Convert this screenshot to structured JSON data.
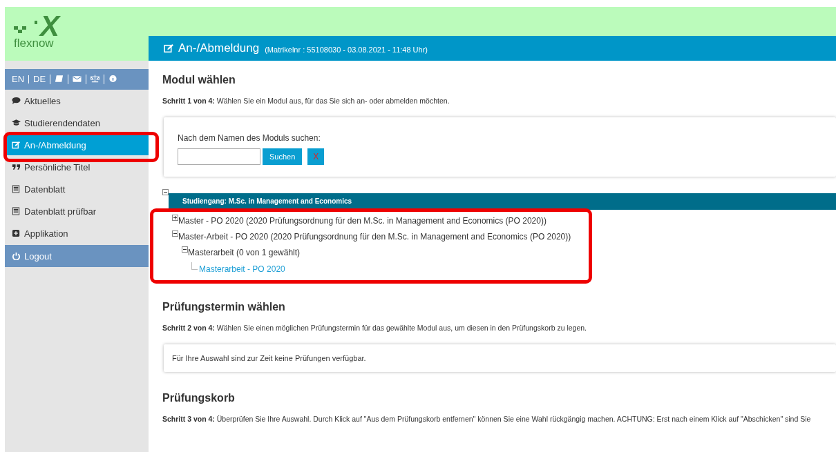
{
  "logo": {
    "mark": "X",
    "name": "flexnow"
  },
  "languages": [
    {
      "label": "EN",
      "selected": false
    },
    {
      "label": "DE",
      "selected": false
    }
  ],
  "sidebar": {
    "items": [
      {
        "label": "Aktuelles",
        "selected": false,
        "kind": "link"
      },
      {
        "label": "Studierendendaten",
        "selected": false,
        "kind": "link"
      },
      {
        "label": "An-/Abmeldung",
        "selected": true,
        "kind": "link"
      },
      {
        "label": "Persönliche Titel",
        "selected": false,
        "kind": "link"
      },
      {
        "label": "Datenblatt",
        "selected": false,
        "kind": "link"
      },
      {
        "label": "Datenblatt prüfbar",
        "selected": false,
        "kind": "link"
      },
      {
        "label": "Applikation",
        "selected": false,
        "kind": "link"
      },
      {
        "label": "Logout",
        "selected": false,
        "kind": "action"
      }
    ]
  },
  "page_title": {
    "title": "An-/Abmeldung",
    "subtitle": "(Matrikelnr : 55108030 - 03.08.2021 - 11:48 Uhr)"
  },
  "sections": [
    {
      "heading": "Modul wählen",
      "step": "**Schritt 1 von 4:** Wählen Sie ein Modul aus, für das Sie sich an- oder abmelden möchten.",
      "kind": "search",
      "search": {
        "label": "Nach dem Namen des Moduls suchen:",
        "button": "Suchen",
        "clear": "X"
      },
      "tree": {
        "label": "Studiengang: M.Sc. in Management and Economics",
        "expanded": true,
        "children": [
          {
            "label": "Master - PO 2020 (2020 Prüfungsordnung für den M.Sc. in Management and Economics (PO 2020))",
            "expanded": false
          },
          {
            "label": "Master-Arbeit - PO 2020 (2020 Prüfungsordnung für den M.Sc. in Management and Economics (PO 2020))",
            "expanded": true,
            "children": [
              {
                "label": "Masterarbeit (0 von 1 gewählt)",
                "expanded": true,
                "children": [
                  {
                    "label": "Masterarbeit - PO 2020",
                    "kind": "leaf"
                  }
                ]
              }
            ]
          }
        ]
      }
    },
    {
      "heading": "Prüfungstermin wählen",
      "step": "**Schritt 2 von 4:** Wählen Sie einen möglichen Prüfungstermin für das gewählte Modul aus, um diesen in den Prüfungskorb zu legen.",
      "kind": "notice",
      "notice": "Für Ihre Auswahl sind zur Zeit keine Prüfungen verfügbar."
    },
    {
      "heading": "Prüfungskorb",
      "step": "**Schritt 3 von 4:** Überprüfen Sie Ihre Auswahl. Durch Klick auf \"Aus dem Prüfungskorb entfernen\" können Sie eine Wahl rückgängig machen. ACHTUNG: Erst nach einem Klick auf \"Abschicken\" sind Sie",
      "kind": "text"
    }
  ]
}
